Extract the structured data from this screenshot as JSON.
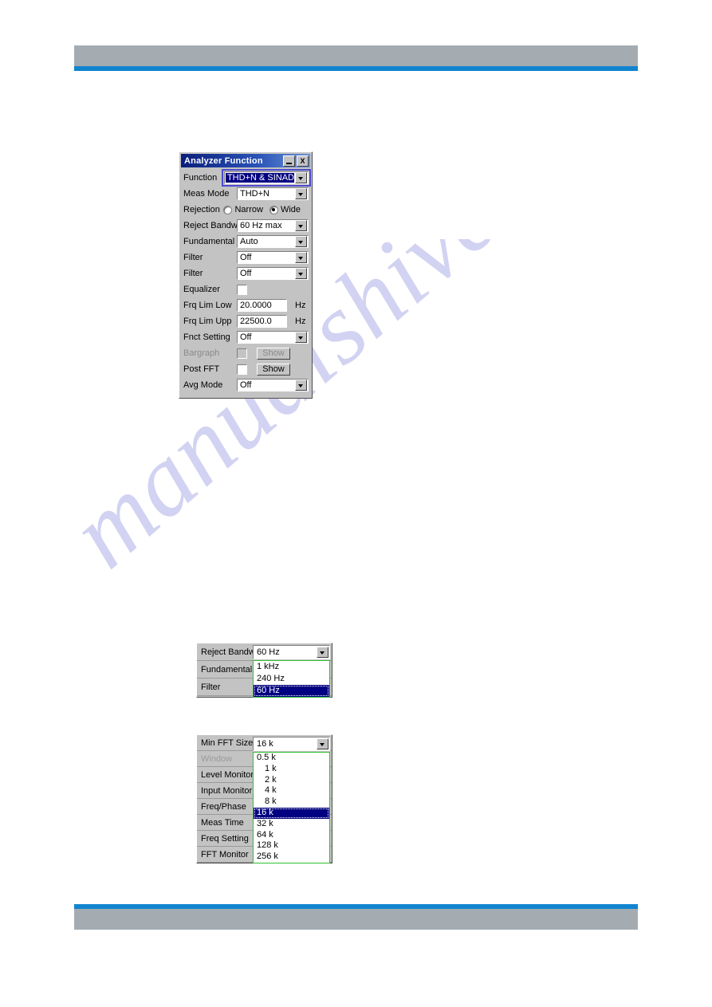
{
  "page": {
    "watermark_text": "manualshive.com",
    "header_color": "#a4acb2",
    "rule_color": "#1184ce"
  },
  "analyzer_dialog": {
    "title": "Analyzer Function",
    "titlebar_buttons": [
      {
        "name": "minimize",
        "label": ""
      },
      {
        "name": "close",
        "label": "X"
      }
    ],
    "rows": [
      {
        "label": "Function",
        "type": "combo",
        "value": "THD+N & SINAD",
        "selected": true
      },
      {
        "label": "Meas Mode",
        "type": "combo",
        "value": "THD+N"
      },
      {
        "label": "Rejection",
        "type": "radio",
        "options": [
          "Narrow",
          "Wide"
        ],
        "selected_option": "Wide"
      },
      {
        "label": "Reject Bandw",
        "type": "combo",
        "value": "60 Hz max"
      },
      {
        "label": "Fundamental",
        "type": "combo",
        "value": "Auto"
      },
      {
        "label": "Filter",
        "type": "combo",
        "value": "Off"
      },
      {
        "label": "Filter",
        "type": "combo",
        "value": "Off"
      },
      {
        "label": "Equalizer",
        "type": "check",
        "checked": false
      },
      {
        "label": "Frq Lim Low",
        "type": "text",
        "value": "20.0000",
        "unit": "Hz"
      },
      {
        "label": "Frq Lim Upp",
        "type": "text",
        "value": "22500.0",
        "unit": "Hz"
      },
      {
        "label": "Fnct Setting",
        "type": "combo",
        "value": "Off"
      },
      {
        "label": "Bargraph",
        "type": "check-btn",
        "checked": false,
        "button": "Show",
        "disabled": true
      },
      {
        "label": "Post FFT",
        "type": "check-btn",
        "checked": false,
        "button": "Show",
        "disabled": false
      },
      {
        "label": "Avg Mode",
        "type": "combo",
        "value": "Off"
      }
    ]
  },
  "reject_bandw_panel": {
    "rows": [
      {
        "label": "Reject Bandw"
      },
      {
        "label": "Fundamental"
      },
      {
        "label": "Filter"
      }
    ],
    "combo_value": "60 Hz",
    "options": [
      "1 kHz",
      "240 Hz",
      "60 Hz"
    ],
    "selected": "60 Hz"
  },
  "min_fft_panel": {
    "rows": [
      {
        "label": "Min FFT Size",
        "disabled": false
      },
      {
        "label": "Window",
        "disabled": true
      },
      {
        "label": "Level Monitor",
        "disabled": false
      },
      {
        "label": "Input Monitor",
        "disabled": false
      },
      {
        "label": "Freq/Phase",
        "disabled": false
      },
      {
        "label": "Meas Time",
        "disabled": false
      },
      {
        "label": "Freq Setting",
        "disabled": false
      },
      {
        "label": "FFT Monitor",
        "disabled": false
      }
    ],
    "combo_value": "16 k",
    "options": [
      "0.5 k",
      "1 k",
      "2 k",
      "4 k",
      "8 k",
      "16 k",
      "32 k",
      "64 k",
      "128 k",
      "256 k"
    ],
    "selected": "16 k"
  }
}
